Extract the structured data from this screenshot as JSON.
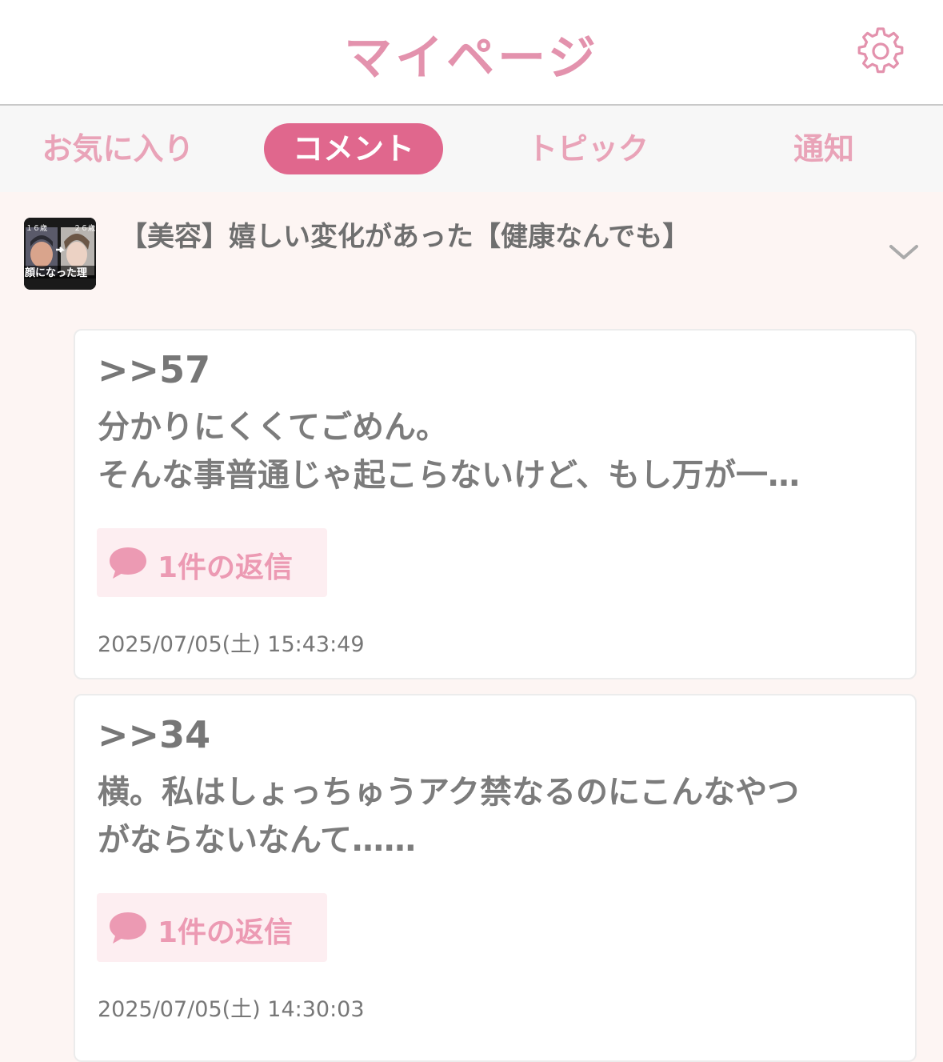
{
  "header": {
    "title": "マイページ",
    "settings_icon": "gear-icon"
  },
  "tabs": [
    {
      "label": "お気に入り",
      "active": false
    },
    {
      "label": "コメント",
      "active": true
    },
    {
      "label": "トピック",
      "active": false
    },
    {
      "label": "通知",
      "active": false
    }
  ],
  "topic": {
    "title": "【美容】嬉しい変化があった【健康なんでも】",
    "thumbnail": {
      "left_label": "１６歳",
      "right_label": "２６歳",
      "caption": "顔になった理"
    },
    "expand_icon": "chevron-down-icon"
  },
  "comments": [
    {
      "anchor": ">>57",
      "lines": [
        "分かりにくくてごめん。",
        "そんな事普通じゃ起こらないけど、もし万が一…"
      ],
      "reply_label": "1件の返信",
      "timestamp": "2025/07/05(土) 15:43:49"
    },
    {
      "anchor": ">>34",
      "lines": [
        "横。私はしょっちゅうアク禁なるのにこんなやつ",
        "がならないなんて……"
      ],
      "reply_label": "1件の返信",
      "timestamp": "2025/07/05(土) 14:30:03"
    }
  ],
  "colors": {
    "accent": "#e0678d",
    "accent_light": "#e392ad",
    "reply_bg": "#fdeef1"
  }
}
